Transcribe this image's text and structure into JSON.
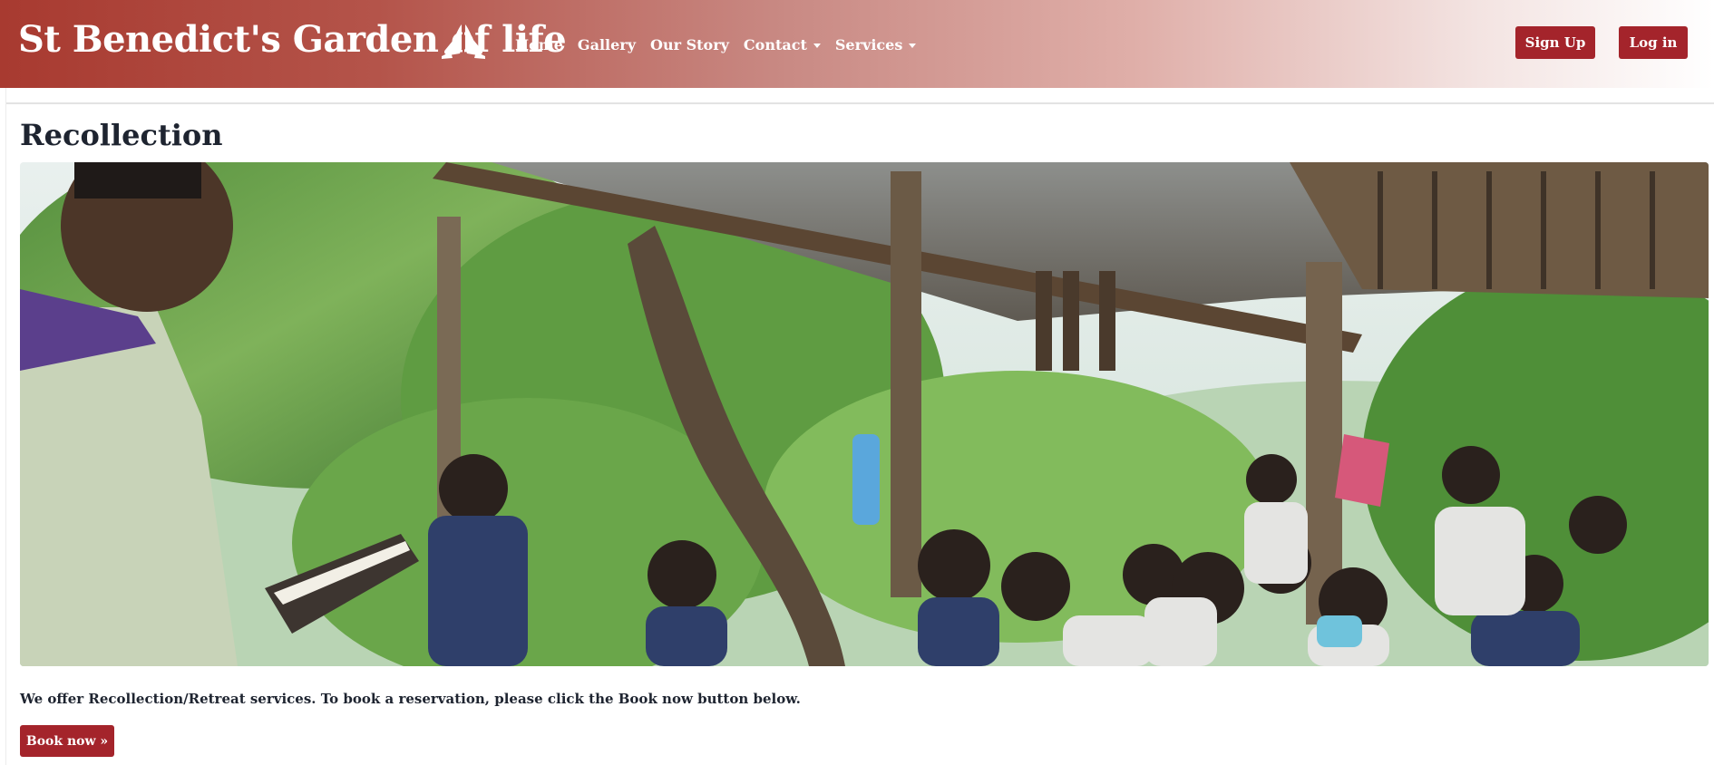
{
  "navbar": {
    "brand": "St Benedict's Garden of life",
    "brand_icon": "praying-hands-icon",
    "links": [
      {
        "label": "Home",
        "dropdown": false
      },
      {
        "label": "Gallery",
        "dropdown": false
      },
      {
        "label": "Our Story",
        "dropdown": false
      },
      {
        "label": "Contact",
        "dropdown": true
      },
      {
        "label": "Services",
        "dropdown": true
      }
    ],
    "signup_label": "Sign Up",
    "login_label": "Log in"
  },
  "main": {
    "title": "Recollection",
    "image_subject": "outdoor recollection gathering under a bamboo hut",
    "description": "We offer Recollection/Retreat services. To book a reservation, please click the Book now button below.",
    "book_label": "Book now »"
  },
  "colors": {
    "brand_red": "#a4242b",
    "navbar_start": "#a83a30",
    "navbar_end": "#ffffff",
    "text_dark": "#1e2430"
  }
}
